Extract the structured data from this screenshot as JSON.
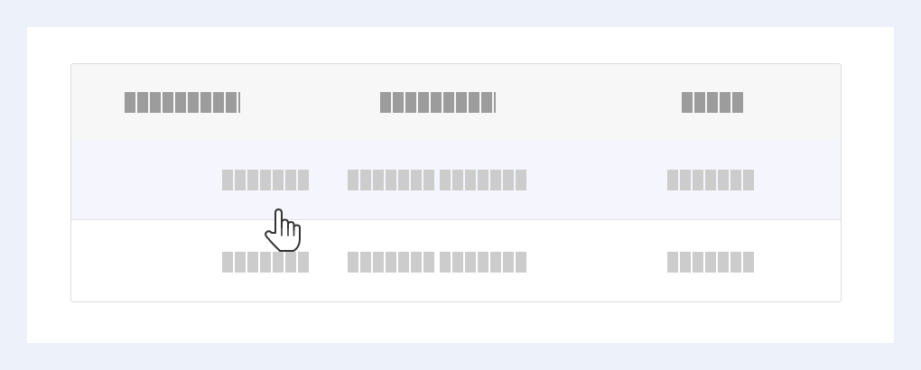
{
  "table": {
    "header": {
      "col1": "█████████",
      "col2": "█████████",
      "col3": "█████"
    },
    "rows": [
      {
        "col1": "███████",
        "col2_a": "███████",
        "col2_b": "███████",
        "col3": "███████",
        "hovered": true
      },
      {
        "col1": "███████",
        "col2_a": "███████",
        "col2_b": "███████",
        "col3": "███████",
        "hovered": false
      }
    ]
  },
  "cursor": {
    "icon": "hand-pointer-icon"
  },
  "colors": {
    "page_bg": "#edf1f9",
    "panel_bg": "#ffffff",
    "header_bg": "#f7f7f7",
    "hover_row_bg": "#f5f6fd",
    "header_text": "#9c9c9c",
    "body_text": "#cccccc"
  }
}
